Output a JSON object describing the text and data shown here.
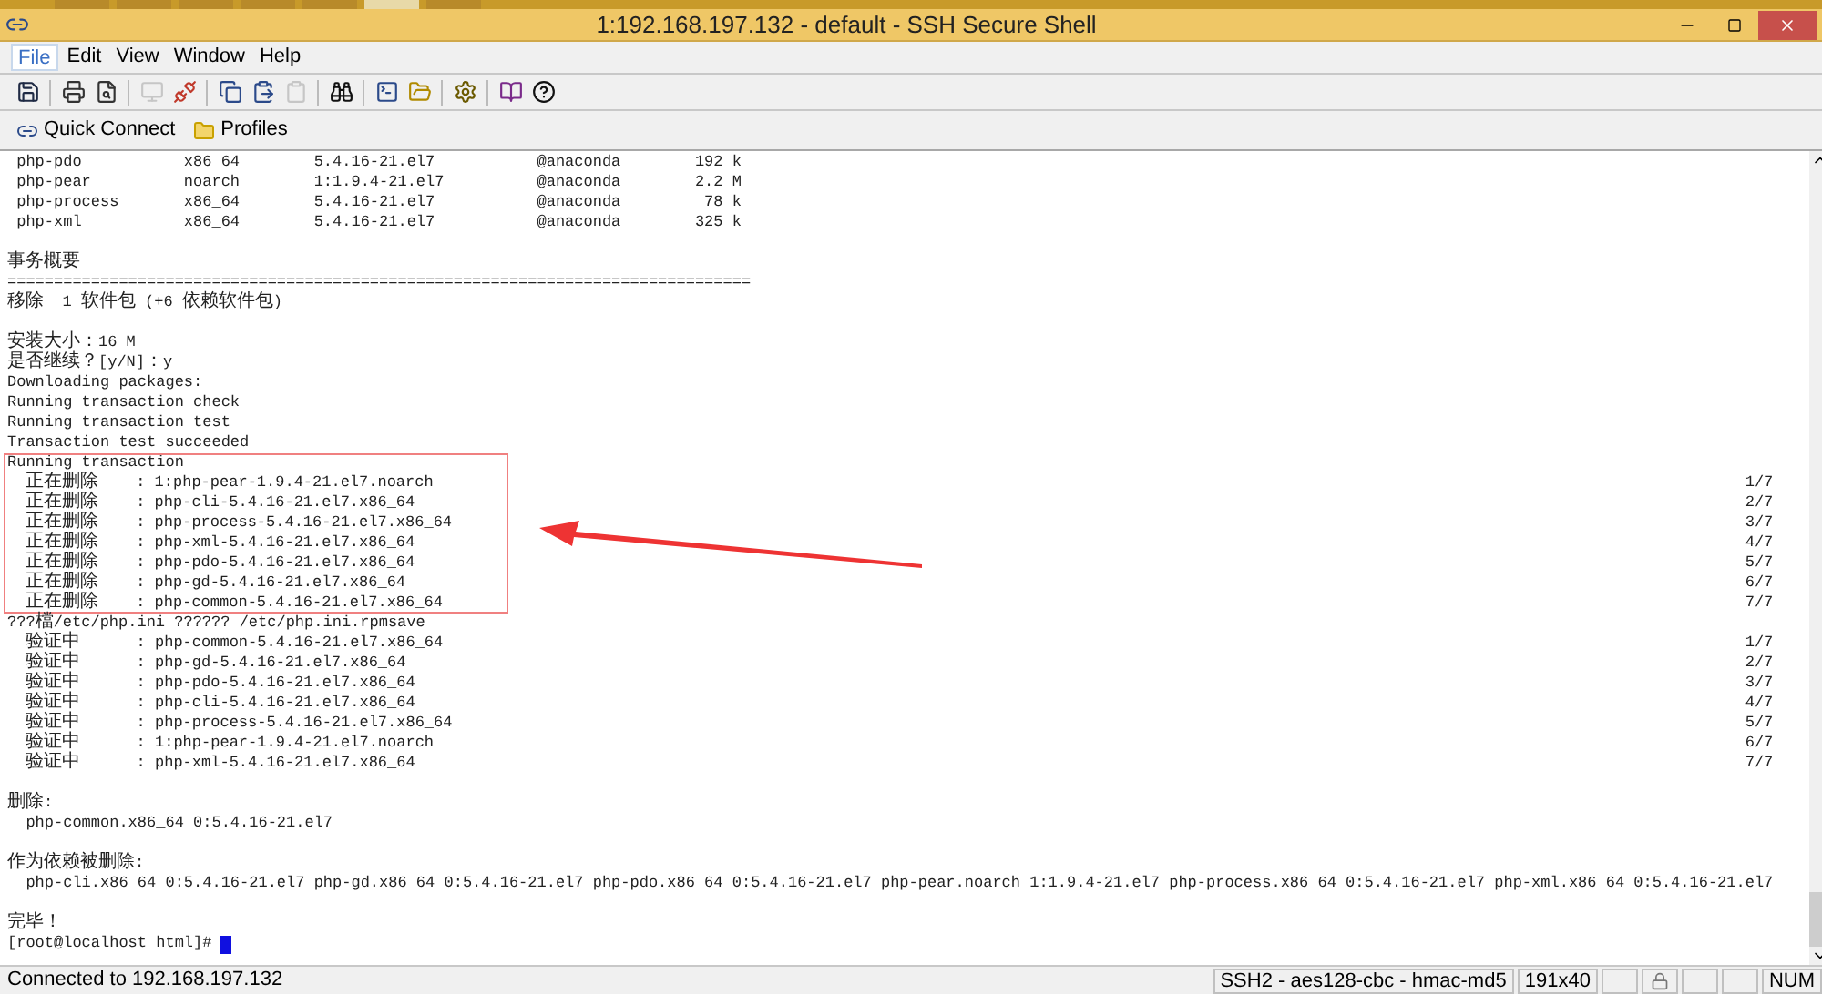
{
  "window": {
    "title": "1:192.168.197.132 - default - SSH Secure Shell"
  },
  "menu": [
    {
      "label": "File",
      "selected": true
    },
    {
      "label": "Edit",
      "selected": false
    },
    {
      "label": "View",
      "selected": false
    },
    {
      "label": "Window",
      "selected": false
    },
    {
      "label": "Help",
      "selected": false
    }
  ],
  "toolbar": [
    {
      "kind": "save",
      "disabled": false
    },
    {
      "kind": "sep"
    },
    {
      "kind": "print",
      "disabled": false
    },
    {
      "kind": "preview",
      "disabled": false
    },
    {
      "kind": "sep"
    },
    {
      "kind": "connect",
      "disabled": true
    },
    {
      "kind": "disconnect",
      "disabled": false
    },
    {
      "kind": "sep"
    },
    {
      "kind": "copy",
      "disabled": false
    },
    {
      "kind": "paste",
      "disabled": false
    },
    {
      "kind": "clipboard",
      "disabled": true
    },
    {
      "kind": "sep"
    },
    {
      "kind": "find",
      "disabled": false
    },
    {
      "kind": "sep"
    },
    {
      "kind": "terminal",
      "disabled": false
    },
    {
      "kind": "files",
      "disabled": false
    },
    {
      "kind": "sep"
    },
    {
      "kind": "settings",
      "disabled": false
    },
    {
      "kind": "sep"
    },
    {
      "kind": "help",
      "disabled": false
    },
    {
      "kind": "whatsthis",
      "disabled": false
    }
  ],
  "quickbar": [
    {
      "kind": "connect",
      "label": "Quick Connect"
    },
    {
      "kind": "folder",
      "label": "Profiles"
    }
  ],
  "terminal": {
    "blocks": [
      {
        "highlighted": false,
        "lines": [
          {
            "kind": "text",
            "text": " php-pdo           x86_64        5.4.16-21.el7           @anaconda        192 k"
          },
          {
            "kind": "text",
            "text": " php-pear          noarch        1:1.9.4-21.el7          @anaconda        2.2 M"
          },
          {
            "kind": "text",
            "text": " php-process       x86_64        5.4.16-21.el7           @anaconda         78 k"
          },
          {
            "kind": "text",
            "text": " php-xml           x86_64        5.4.16-21.el7           @anaconda        325 k"
          },
          {
            "kind": "blank"
          },
          {
            "kind": "text",
            "text": "事务概要"
          },
          {
            "kind": "text",
            "text": "================================================================================"
          },
          {
            "kind": "text",
            "text": "移除  1 软件包 (+6 依赖软件包)"
          },
          {
            "kind": "blank"
          },
          {
            "kind": "text",
            "text": "安装大小：16 M"
          },
          {
            "kind": "text",
            "text": "是否继续？[y/N]：y"
          },
          {
            "kind": "text",
            "text": "Downloading packages:"
          },
          {
            "kind": "text",
            "text": "Running transaction check"
          },
          {
            "kind": "text",
            "text": "Running transaction test"
          },
          {
            "kind": "text",
            "text": "Transaction test succeeded"
          }
        ]
      },
      {
        "highlighted": true,
        "lines": [
          {
            "kind": "text",
            "text": "Running transaction"
          },
          {
            "kind": "text",
            "text": "  正在删除    : 1:php-pear-1.9.4-21.el7.noarch",
            "right": "1/7"
          },
          {
            "kind": "text",
            "text": "  正在删除    : php-cli-5.4.16-21.el7.x86_64",
            "right": "2/7"
          },
          {
            "kind": "text",
            "text": "  正在删除    : php-process-5.4.16-21.el7.x86_64",
            "right": "3/7"
          },
          {
            "kind": "text",
            "text": "  正在删除    : php-xml-5.4.16-21.el7.x86_64",
            "right": "4/7"
          },
          {
            "kind": "text",
            "text": "  正在删除    : php-pdo-5.4.16-21.el7.x86_64",
            "right": "5/7"
          },
          {
            "kind": "text",
            "text": "  正在删除    : php-gd-5.4.16-21.el7.x86_64",
            "right": "6/7"
          },
          {
            "kind": "text",
            "text": "  正在删除    : php-common-5.4.16-21.el7.x86_64",
            "right": "7/7"
          }
        ]
      },
      {
        "highlighted": false,
        "lines": [
          {
            "kind": "text",
            "text": "???檔/etc/php.ini ?????? /etc/php.ini.rpmsave"
          },
          {
            "kind": "text",
            "text": "  验证中      : php-common-5.4.16-21.el7.x86_64",
            "right": "1/7"
          },
          {
            "kind": "text",
            "text": "  验证中      : php-gd-5.4.16-21.el7.x86_64",
            "right": "2/7"
          },
          {
            "kind": "text",
            "text": "  验证中      : php-pdo-5.4.16-21.el7.x86_64",
            "right": "3/7"
          },
          {
            "kind": "text",
            "text": "  验证中      : php-cli-5.4.16-21.el7.x86_64",
            "right": "4/7"
          },
          {
            "kind": "text",
            "text": "  验证中      : php-process-5.4.16-21.el7.x86_64",
            "right": "5/7"
          },
          {
            "kind": "text",
            "text": "  验证中      : 1:php-pear-1.9.4-21.el7.noarch",
            "right": "6/7"
          },
          {
            "kind": "text",
            "text": "  验证中      : php-xml-5.4.16-21.el7.x86_64",
            "right": "7/7"
          },
          {
            "kind": "blank"
          },
          {
            "kind": "text",
            "text": "删除:"
          },
          {
            "kind": "text",
            "text": "  php-common.x86_64 0:5.4.16-21.el7"
          },
          {
            "kind": "blank"
          },
          {
            "kind": "text",
            "text": "作为依赖被删除:"
          },
          {
            "kind": "text",
            "text": "  php-cli.x86_64 0:5.4.16-21.el7 php-gd.x86_64 0:5.4.16-21.el7 php-pdo.x86_64 0:5.4.16-21.el7 php-pear.noarch 1:1.9.4-21.el7 php-process.x86_64 0:5.4.16-21.el7 php-xml.x86_64 0:5.4.16-21.el7"
          },
          {
            "kind": "blank"
          },
          {
            "kind": "text",
            "text": "完毕！"
          },
          {
            "kind": "prompt",
            "text": "[root@localhost html]# "
          }
        ]
      }
    ]
  },
  "status_bar": {
    "left": "Connected to 192.168.197.132",
    "panels": [
      {
        "kind": "text",
        "text": "SSH2 - aes128-cbc - hmac-md5"
      },
      {
        "kind": "text",
        "text": "191x40"
      },
      {
        "kind": "empty"
      },
      {
        "kind": "icon"
      },
      {
        "kind": "empty"
      },
      {
        "kind": "empty"
      },
      {
        "kind": "text",
        "text": "NUM"
      }
    ]
  }
}
